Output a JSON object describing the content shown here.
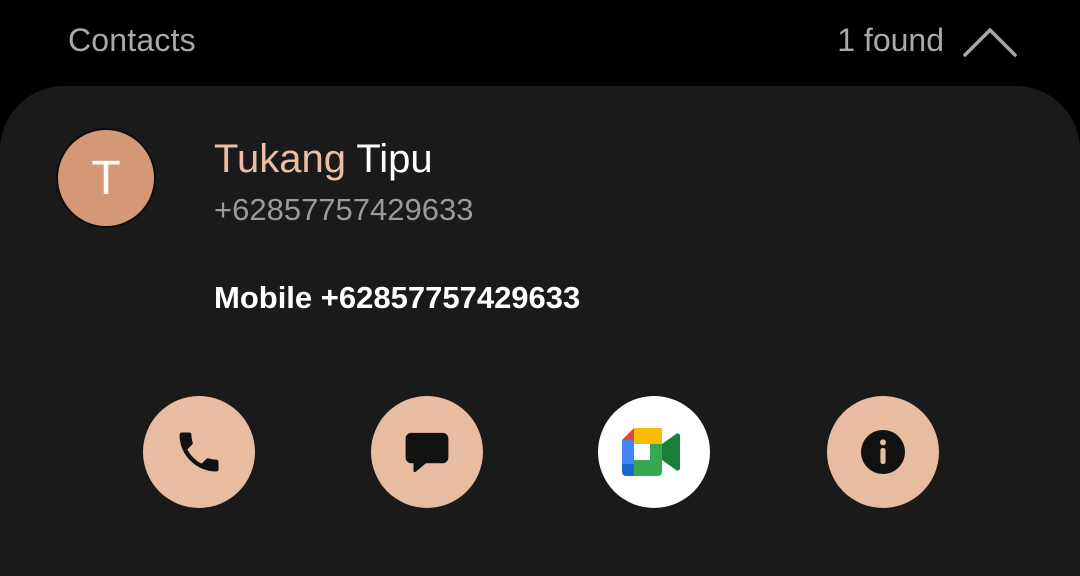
{
  "header": {
    "title": "Contacts",
    "found": "1 found",
    "collapse_icon": "chevron-up-icon"
  },
  "contact": {
    "avatar_initial": "T",
    "name_match": "Tukang",
    "name_rest": " Tipu",
    "number": "+62857757429633",
    "mobile_label": "Mobile",
    "mobile_number": "+62857757429633"
  },
  "actions": [
    {
      "icon": "phone-icon"
    },
    {
      "icon": "message-icon"
    },
    {
      "icon": "google-meet-icon"
    },
    {
      "icon": "info-icon"
    }
  ],
  "colors": {
    "background": "#000000",
    "card": "#1a1a1a",
    "accent": "#e8bca1",
    "avatar": "#d49876",
    "secondary_text": "#a9a9a9"
  }
}
